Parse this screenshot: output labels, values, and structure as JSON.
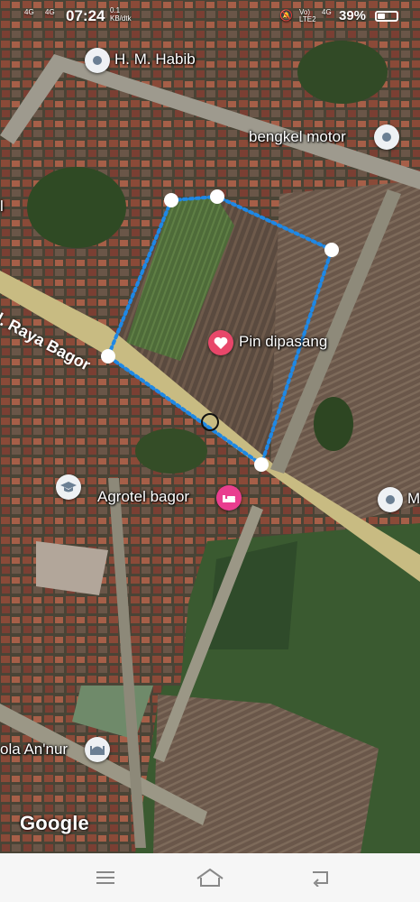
{
  "status_bar": {
    "left_small": "4G",
    "left_small2": "4G",
    "time": "07:24",
    "speed": "0.1",
    "speed_unit": "KB/dtk",
    "volte": "Vo)",
    "lte": "LTE2",
    "net": "4G",
    "battery_text": "39%",
    "battery_level": 0.39
  },
  "map": {
    "places": [
      {
        "label": "H. M. Habib",
        "icon": "place-pin-icon"
      },
      {
        "label": "bengkel motor",
        "icon": "place-pin-icon"
      },
      {
        "label": "Pin dipasang",
        "icon": "heart-pin-icon"
      },
      {
        "label": "Agrotel bagor",
        "icon": "hotel-bed-icon"
      },
      {
        "label": "M",
        "icon": "place-pin-icon"
      },
      {
        "label": "ola An'nur",
        "icon": "mosque-icon"
      },
      {
        "label": "l",
        "icon": ""
      }
    ],
    "road_label": "l. Raya Bagor",
    "school_icon": "school-cap-icon",
    "attribution": "Google",
    "boundary_color": "#1e88e5",
    "pin_color": "#e8476a",
    "hotel_color": "#e93e8f"
  },
  "nav_bar": {
    "menu_icon": "menu-lines-icon",
    "home_icon": "home-icon",
    "back_icon": "back-arrow-icon"
  }
}
